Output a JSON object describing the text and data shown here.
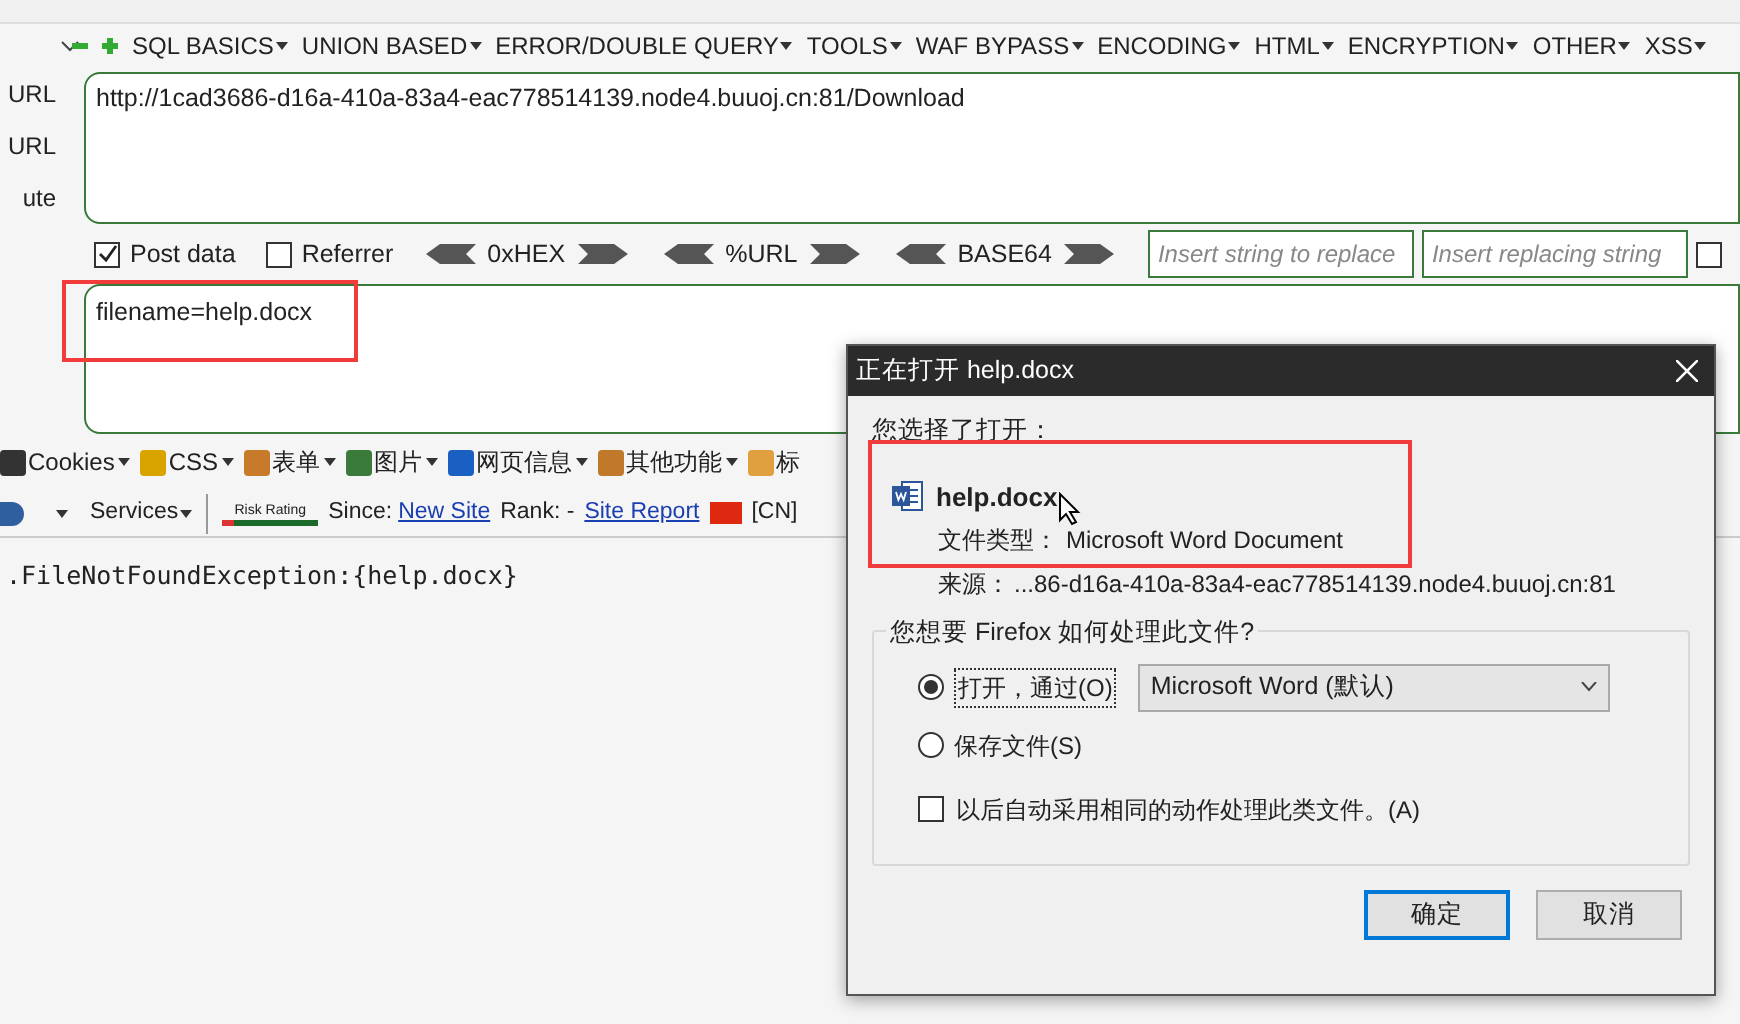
{
  "side_labels": [
    "URL",
    "URL",
    "ute"
  ],
  "menus": [
    "SQL BASICS",
    "UNION BASED",
    "ERROR/DOUBLE QUERY",
    "TOOLS",
    "WAF BYPASS",
    "ENCODING",
    "HTML",
    "ENCRYPTION",
    "OTHER",
    "XSS"
  ],
  "url_field": {
    "value": "http://1cad3686-d16a-410a-83a4-eac778514139.node4.buuoj.cn:81/Download"
  },
  "options": [
    {
      "label": "Post data",
      "checked": true
    },
    {
      "label": "Referrer",
      "checked": false
    }
  ],
  "encoders": [
    "0xHEX",
    "%URL",
    "BASE64"
  ],
  "replace_fields": [
    {
      "placeholder": "Insert string to replace"
    },
    {
      "placeholder": "Insert replacing string"
    }
  ],
  "replace_toggle": {
    "checked": false
  },
  "post_field": {
    "value": "filename=help.docx"
  },
  "devtools": [
    "Cookies",
    "CSS",
    "表单",
    "图片",
    "网页信息",
    "其他功能",
    "标"
  ],
  "siteinfo": {
    "services": "Services",
    "risk": "Risk Rating",
    "since": "Since:",
    "new_site": "New Site",
    "rank": "Rank: -",
    "report": "Site Report",
    "country": "[CN]"
  },
  "page_text": ".FileNotFoundException:{help.docx}",
  "dialog": {
    "title": "正在打开 help.docx",
    "intro": "您选择了打开：",
    "filename": "help.docx",
    "type_label": "文件类型：",
    "type_value": "Microsoft Word Document",
    "source_label": "来源：",
    "source_value": "...86-d16a-410a-83a4-eac778514139.node4.buuoj.cn:81",
    "question": "您想要 Firefox 如何处理此文件?",
    "actions": [
      {
        "label": "打开，通过(O)",
        "selected": true
      },
      {
        "label": "保存文件(S)",
        "selected": false
      }
    ],
    "app": "Microsoft Word (默认)",
    "remember": {
      "label": "以后自动采用相同的动作处理此类文件。(A)",
      "checked": false
    },
    "buttons": [
      "确定",
      "取消"
    ]
  }
}
